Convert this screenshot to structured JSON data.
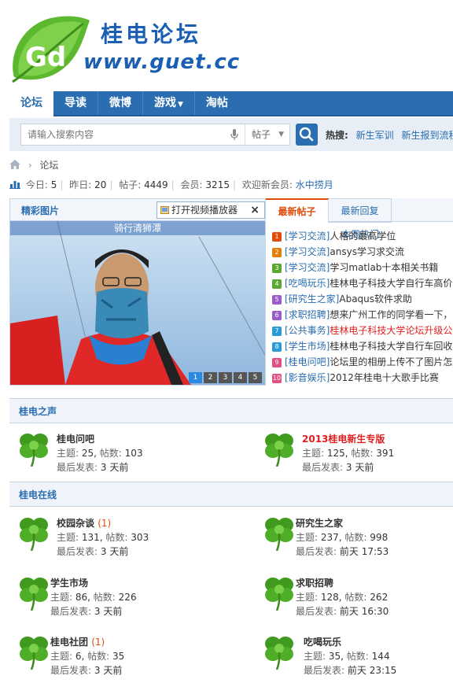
{
  "header": {
    "logo_text_cn": "桂电论坛",
    "logo_url": "www.guet.cc",
    "logo_badge": "Gd"
  },
  "nav": {
    "items": [
      {
        "label": "论坛"
      },
      {
        "label": "导读"
      },
      {
        "label": "微博"
      },
      {
        "label": "游戏"
      },
      {
        "label": "淘帖"
      }
    ]
  },
  "search": {
    "placeholder": "请输入搜索内容",
    "type": "帖子",
    "hot_label": "热搜:",
    "hot_links": [
      "新生军训",
      "新生报到流程"
    ]
  },
  "breadcrumb": {
    "current": "论坛"
  },
  "stats": {
    "today_label": "今日:",
    "today": "5",
    "yesterday_label": "昨日:",
    "yesterday": "20",
    "posts_label": "帖子:",
    "posts": "4449",
    "members_label": "会员:",
    "members": "3215",
    "welcome_label": "欢迎新会员:",
    "newest_member": "水中捞月"
  },
  "slideshow": {
    "title": "精彩图片",
    "video_button": "打开视频播放器",
    "caption": "骑行清狮潭",
    "pages": [
      "1",
      "2",
      "3",
      "4",
      "5"
    ],
    "active_page": 1
  },
  "posts": {
    "tabs": [
      "最新帖子",
      "最新回复",
      "本周热门"
    ],
    "list": [
      {
        "num": "1",
        "color": "#e14b0a",
        "cat": "[学习交流]",
        "title": "人格的最高学位",
        "red": false
      },
      {
        "num": "2",
        "color": "#e17f0a",
        "cat": "[学习交流]",
        "title": "ansys学习求交流",
        "red": false
      },
      {
        "num": "3",
        "color": "#5aa830",
        "cat": "[学习交流]",
        "title": "学习matlab十本相关书籍",
        "red": false
      },
      {
        "num": "4",
        "color": "#5aa830",
        "cat": "[吃喝玩乐]",
        "title": "桂林电子科技大学自行车高价",
        "red": false
      },
      {
        "num": "5",
        "color": "#9a5ac8",
        "cat": "[研究生之家]",
        "title": "Abaqus软件求助",
        "red": false
      },
      {
        "num": "6",
        "color": "#9a5ac8",
        "cat": "[求职招聘]",
        "title": "想来广州工作的同学看一下，",
        "red": false
      },
      {
        "num": "7",
        "color": "#2a9ad8",
        "cat": "[公共事务]",
        "title": "桂林电子科技大学论坛升级公",
        "red": true
      },
      {
        "num": "8",
        "color": "#2a9ad8",
        "cat": "[学生市场]",
        "title": "桂林电子科技大学自行车回收",
        "red": false
      },
      {
        "num": "9",
        "color": "#e05080",
        "cat": "[桂电问吧]",
        "title": "论坛里的相册上传不了图片怎",
        "red": false
      },
      {
        "num": "10",
        "color": "#e05080",
        "cat": "[影音娱乐]",
        "title": "2012年桂电十大歌手比赛",
        "red": false
      }
    ]
  },
  "sections": [
    {
      "title": "桂电之声",
      "forums": [
        {
          "name": "桂电问吧",
          "new": "",
          "hot": false,
          "topics_label": "主题:",
          "topics": "25",
          "posts_label": "帖数:",
          "posts": "103",
          "last_label": "最后发表:",
          "last": "3 天前"
        },
        {
          "name": "2013桂电新生专版",
          "new": "",
          "hot": true,
          "topics_label": "主题:",
          "topics": "125",
          "posts_label": "帖数:",
          "posts": "391",
          "last_label": "最后发表:",
          "last": "3 天前"
        }
      ]
    },
    {
      "title": "桂电在线",
      "forums": [
        {
          "name": "校园杂谈",
          "new": "(1)",
          "hot": false,
          "topics_label": "主题:",
          "topics": "131",
          "posts_label": "帖数:",
          "posts": "303",
          "last_label": "最后发表:",
          "last": "3 天前"
        },
        {
          "name": "研究生之家",
          "new": "",
          "hot": false,
          "topics_label": "主题:",
          "topics": "237",
          "posts_label": "帖数:",
          "posts": "998",
          "last_label": "最后发表:",
          "last": "前天 17:53"
        },
        {
          "name": "学生市场",
          "new": "",
          "hot": false,
          "topics_label": "主题:",
          "topics": "86",
          "posts_label": "帖数:",
          "posts": "226",
          "last_label": "最后发表:",
          "last": "3 天前"
        },
        {
          "name": "求职招聘",
          "new": "",
          "hot": false,
          "topics_label": "主题:",
          "topics": "128",
          "posts_label": "帖数:",
          "posts": "262",
          "last_label": "最后发表:",
          "last": "前天 16:30"
        },
        {
          "name": "桂电社团",
          "new": "(1)",
          "hot": false,
          "topics_label": "主题:",
          "topics": "6",
          "posts_label": "帖数:",
          "posts": "35",
          "last_label": "最后发表:",
          "last": "3 天前"
        },
        {
          "name": "吃喝玩乐",
          "new": "",
          "hot": false,
          "topics_label": "主题:",
          "topics": "35",
          "posts_label": "帖数:",
          "posts": "144",
          "last_label": "最后发表:",
          "last": "前天 23:15"
        }
      ]
    }
  ]
}
